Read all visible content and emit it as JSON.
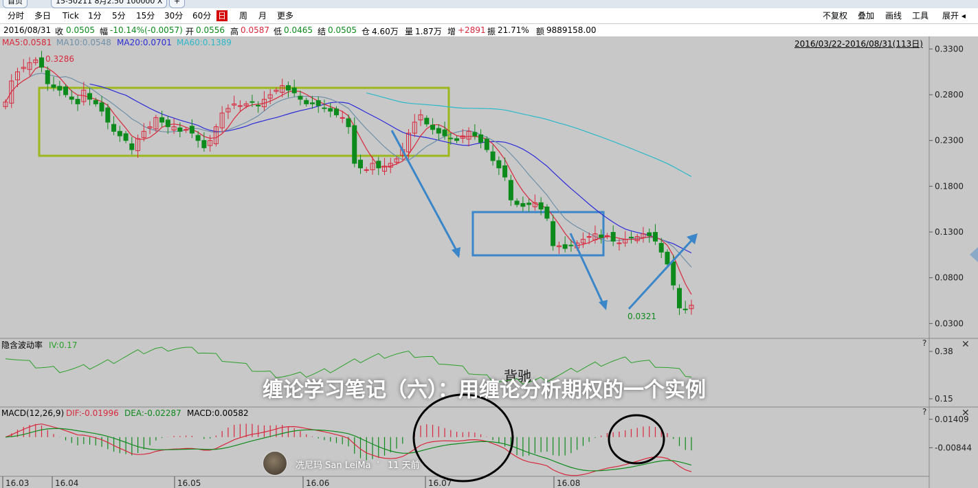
{
  "tabs": [
    {
      "label": "首页"
    },
    {
      "label": "15-50211 8月2.50 100000 X"
    },
    {
      "label": "+"
    }
  ],
  "toolbar": {
    "left": [
      "分时",
      "多日",
      "Tick",
      "1分",
      "5分",
      "15分",
      "30分",
      "60分",
      "日",
      "周",
      "月",
      "更多"
    ],
    "active": "日",
    "right": [
      "不复权",
      "叠加",
      "画线",
      "工具",
      "展开 ◂"
    ]
  },
  "quote": {
    "date": "2016/08/31",
    "close_label": "收",
    "close": "0.0505",
    "change_label": "幅",
    "change": "-10.14%(-0.0057)",
    "open_label": "开",
    "open": "0.0556",
    "high_label": "高",
    "high": "0.0587",
    "low_label": "低",
    "low": "0.0465",
    "settle_label": "结",
    "settle": "0.0505",
    "oi_label": "仓",
    "oi": "4.60万",
    "volume_label": "量",
    "volume": "1.87万",
    "increase_label": "增",
    "increase": "+2891",
    "amp_label": "振",
    "amp": "21.71%",
    "amount_label": "额",
    "amount": "9889158.00"
  },
  "ma": {
    "ma5": "MA5:0.0581",
    "ma10": "MA10:0.0548",
    "ma20": "MA20:0.0701",
    "ma60": "MA60:0.1389"
  },
  "range_label": "2016/03/22-2016/08/31(113日)",
  "colors": {
    "up": "#d8283c",
    "down": "#0d8a1c",
    "ma5": "#d8283c",
    "ma10": "#6f90a8",
    "ma20": "#2b2bd8",
    "ma60": "#2ab8c8",
    "box_green": "#9cb81e",
    "box_blue": "#3a86c8",
    "arrow": "#3a86c8"
  },
  "panels": {
    "iv": {
      "label": "隐含波动率",
      "value": "IV:0.17",
      "annotation": "背驰"
    },
    "macd": {
      "label": "MACD(12,26,9)",
      "dif": "DIF:-0.01996",
      "dea": "DEA:-0.02287",
      "macd": "MACD:0.00582"
    }
  },
  "chart_data": [
    {
      "type": "candlestick",
      "x_start": "2016-03-22",
      "x_end": "2016-08-31",
      "yticks": [
        "0.3300",
        "0.2800",
        "0.2300",
        "0.1800",
        "0.1300",
        "0.0800",
        "0.0300"
      ],
      "xticks": [
        "16.03",
        "16.04",
        "16.05",
        "16.06",
        "16.07",
        "16.08"
      ],
      "ylim": [
        0.016,
        0.337
      ],
      "high_marker": "0.3286",
      "low_marker": "0.0321",
      "closes": [
        0.272,
        0.295,
        0.305,
        0.31,
        0.315,
        0.318,
        0.31,
        0.292,
        0.288,
        0.285,
        0.28,
        0.275,
        0.27,
        0.285,
        0.275,
        0.27,
        0.262,
        0.25,
        0.24,
        0.235,
        0.23,
        0.22,
        0.232,
        0.24,
        0.245,
        0.255,
        0.25,
        0.245,
        0.245,
        0.24,
        0.242,
        0.238,
        0.23,
        0.222,
        0.23,
        0.245,
        0.26,
        0.265,
        0.27,
        0.268,
        0.27,
        0.272,
        0.268,
        0.275,
        0.28,
        0.285,
        0.29,
        0.285,
        0.282,
        0.275,
        0.27,
        0.27,
        0.268,
        0.265,
        0.262,
        0.258,
        0.255,
        0.245,
        0.205,
        0.2,
        0.198,
        0.205,
        0.2,
        0.202,
        0.205,
        0.21,
        0.22,
        0.238,
        0.25,
        0.258,
        0.248,
        0.242,
        0.238,
        0.235,
        0.232,
        0.23,
        0.235,
        0.24,
        0.235,
        0.228,
        0.22,
        0.208,
        0.2,
        0.19,
        0.165,
        0.16,
        0.158,
        0.16,
        0.162,
        0.155,
        0.145,
        0.115,
        0.115,
        0.112,
        0.115,
        0.118,
        0.122,
        0.125,
        0.128,
        0.124,
        0.126,
        0.12,
        0.118,
        0.122,
        0.124,
        0.125,
        0.128,
        0.126,
        0.12,
        0.108,
        0.095,
        0.072,
        0.047,
        0.045,
        0.05
      ],
      "series": [
        {
          "name": "MA5"
        },
        {
          "name": "MA10"
        },
        {
          "name": "MA20"
        },
        {
          "name": "MA60"
        }
      ],
      "annotations": [
        "green consolidation box (Mar–Jun)",
        "blue consolidation box (Jul)",
        "arrows: down, down, up"
      ]
    },
    {
      "type": "line",
      "name": "隐含波动率",
      "yticks": [
        "0.38",
        "0.15"
      ],
      "ylim": [
        0.12,
        0.42
      ]
    },
    {
      "type": "bar",
      "name": "MACD(12,26,9)",
      "yticks": [
        "0.01409",
        "-0.00844"
      ],
      "ylim": [
        -0.03,
        0.02
      ]
    }
  ],
  "overlay": {
    "title": "缠论学习笔记（六）：用缠论分析期权的一个实例",
    "author": "冼尼玛 San LeiMa",
    "separator": "·",
    "time": "11 天前"
  }
}
